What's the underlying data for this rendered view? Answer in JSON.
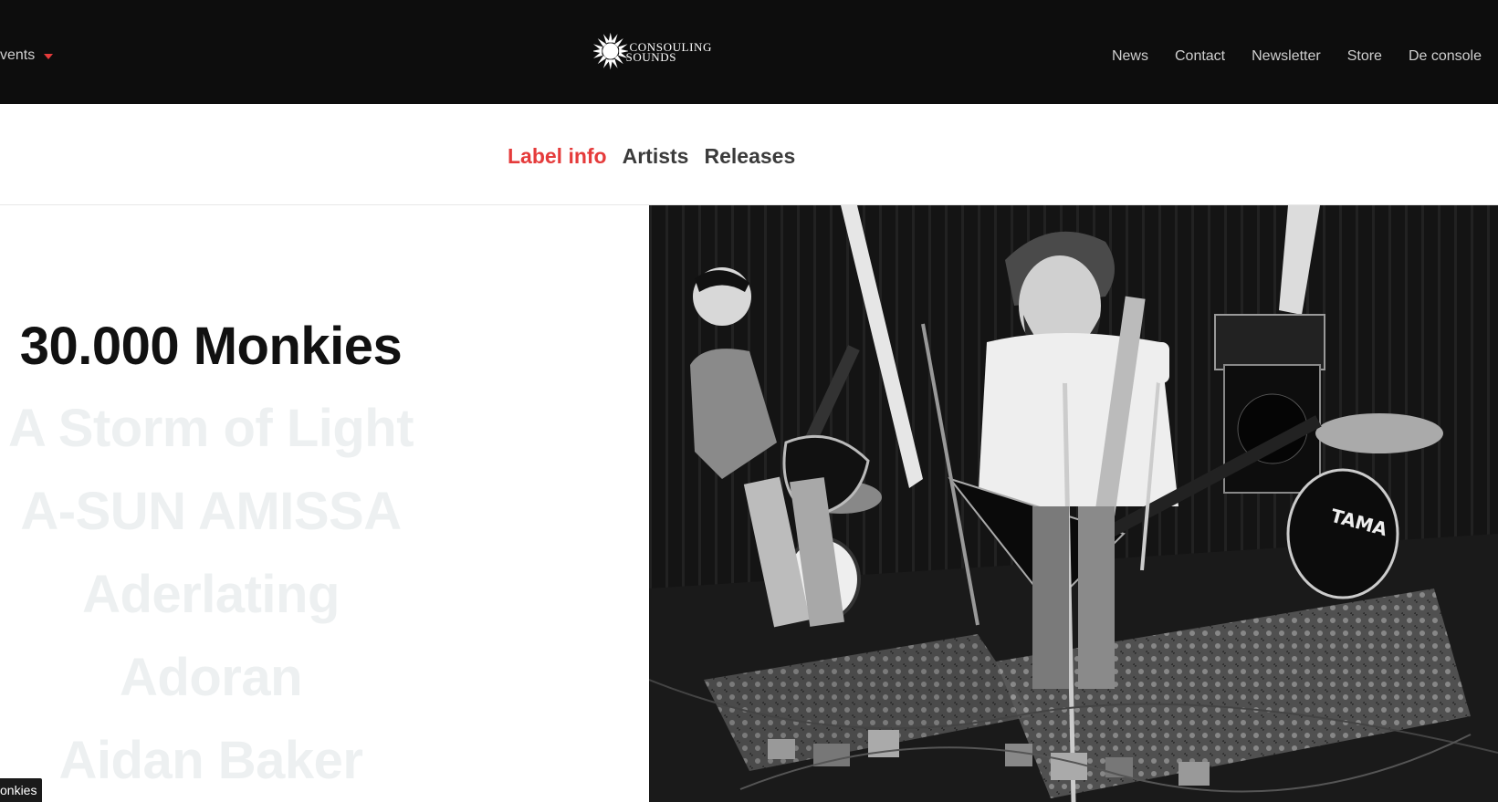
{
  "topbar": {
    "events_label": "vents",
    "logo_text_line1": "CONSOULING",
    "logo_text_line2": "SOUNDS",
    "nav": [
      "News",
      "Contact",
      "Newsletter",
      "Store",
      "De console"
    ]
  },
  "subnav": {
    "items": [
      "Label info",
      "Artists",
      "Releases"
    ],
    "active": "Label info"
  },
  "artists": [
    "30.000 Monkies",
    "A Storm of Light",
    "A-SUN AMISSA",
    "Aderlating",
    "Adoran",
    "Aidan Baker"
  ],
  "tooltip": "onkies",
  "colors": {
    "topbar_bg": "#0d0d0d",
    "accent": "#e53b3b",
    "artist_faded": "#edf0f1",
    "artist_current": "#111111"
  },
  "photo": {
    "description_icon": "band-photo"
  }
}
